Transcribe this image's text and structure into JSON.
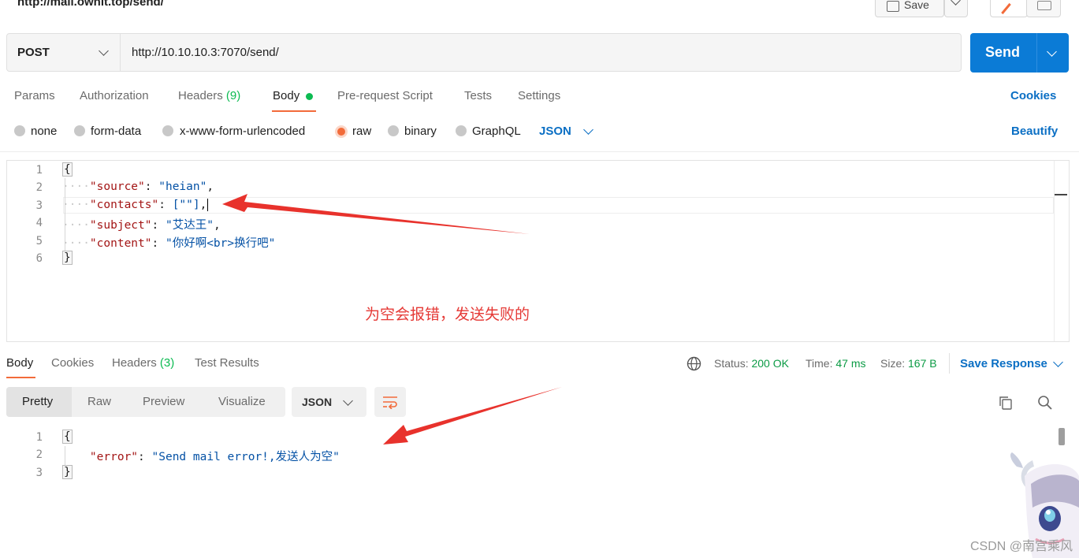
{
  "topbar": {
    "url_title": "http://mail.ownit.top/send/",
    "save_label": "Save"
  },
  "request": {
    "method": "POST",
    "url": "http://10.10.10.3:7070/send/",
    "send_label": "Send"
  },
  "request_tabs": {
    "params": "Params",
    "authorization": "Authorization",
    "headers": "Headers",
    "headers_count": "(9)",
    "body": "Body",
    "prerequest": "Pre-request Script",
    "tests": "Tests",
    "settings": "Settings",
    "cookies": "Cookies"
  },
  "body_types": {
    "none": "none",
    "form_data": "form-data",
    "urlencoded": "x-www-form-urlencoded",
    "raw": "raw",
    "binary": "binary",
    "graphql": "GraphQL",
    "format": "JSON",
    "beautify": "Beautify",
    "selected": "raw"
  },
  "request_body": {
    "line_numbers": [
      "1",
      "2",
      "3",
      "4",
      "5",
      "6"
    ],
    "open_brace": "{",
    "close_brace": "}",
    "source_key": "\"source\"",
    "source_val": "\"heian\"",
    "contacts_key": "\"contacts\"",
    "contacts_val": "[\"\"]",
    "subject_key": "\"subject\"",
    "subject_val": "\"艾达王\"",
    "content_key": "\"content\"",
    "content_val": "\"你好啊<br>换行吧\""
  },
  "annotation": "为空会报错，发送失败的",
  "response_tabs": {
    "body": "Body",
    "cookies": "Cookies",
    "headers": "Headers",
    "headers_count": "(3)",
    "test_results": "Test Results"
  },
  "response_status": {
    "status_label": "Status:",
    "status_value": "200 OK",
    "time_label": "Time:",
    "time_value": "47 ms",
    "size_label": "Size:",
    "size_value": "167 B",
    "save_response": "Save Response"
  },
  "response_view": {
    "pretty": "Pretty",
    "raw": "Raw",
    "preview": "Preview",
    "visualize": "Visualize",
    "format": "JSON"
  },
  "response_body": {
    "line_numbers": [
      "1",
      "2",
      "3"
    ],
    "open_brace": "{",
    "close_brace": "}",
    "error_key": "\"error\"",
    "error_val": "\"Send mail error!,发送人为空\""
  },
  "watermark": "CSDN @南宫乘风",
  "colors": {
    "accent_orange": "#f26b3a",
    "send_blue": "#0b7bd6",
    "status_green": "#0c9b45",
    "annotation_red": "#e53935"
  }
}
